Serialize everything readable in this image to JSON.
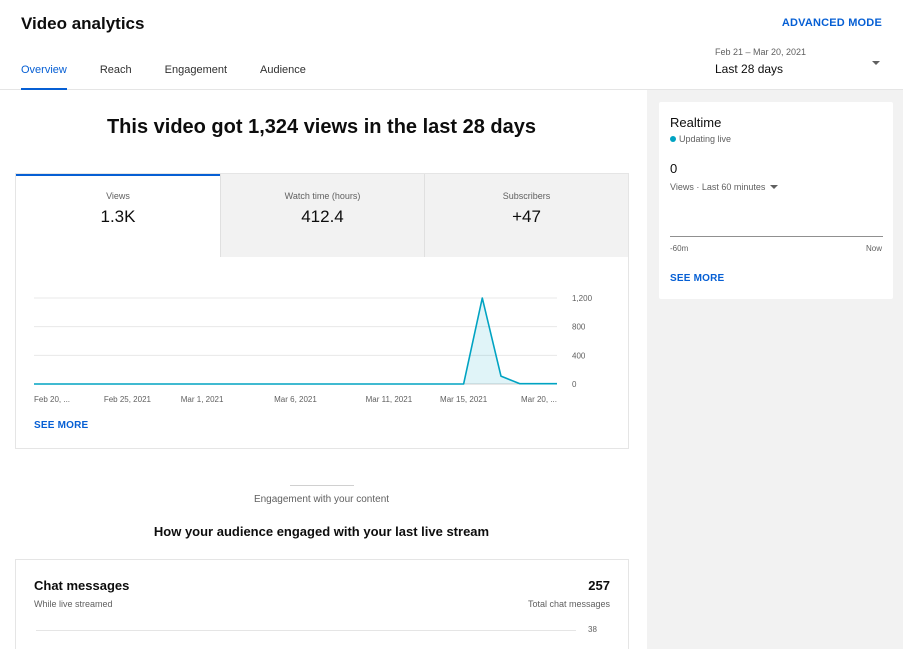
{
  "header": {
    "title": "Video analytics",
    "advanced_mode": "ADVANCED MODE",
    "tabs": [
      {
        "label": "Overview",
        "active": true
      },
      {
        "label": "Reach",
        "active": false
      },
      {
        "label": "Engagement",
        "active": false
      },
      {
        "label": "Audience",
        "active": false
      }
    ],
    "date_range": "Feb 21 – Mar 20, 2021",
    "date_label": "Last 28 days"
  },
  "main": {
    "headline": "This video got 1,324 views in the last 28 days",
    "metrics": [
      {
        "label": "Views",
        "value": "1.3K",
        "active": true
      },
      {
        "label": "Watch time (hours)",
        "value": "412.4",
        "active": false
      },
      {
        "label": "Subscribers",
        "value": "+47",
        "active": false
      }
    ],
    "see_more": "SEE MORE",
    "engagement_label": "Engagement with your content",
    "engagement_title": "How your audience engaged with your last live stream",
    "chat": {
      "title": "Chat messages",
      "subtitle": "While live streamed",
      "count": "257",
      "count_label": "Total chat messages",
      "axis_tick": "38"
    }
  },
  "chart_data": {
    "type": "area",
    "x": [
      "Feb 20",
      "Feb 21",
      "Feb 22",
      "Feb 23",
      "Feb 24",
      "Feb 25",
      "Feb 26",
      "Feb 27",
      "Feb 28",
      "Mar 1",
      "Mar 2",
      "Mar 3",
      "Mar 4",
      "Mar 5",
      "Mar 6",
      "Mar 7",
      "Mar 8",
      "Mar 9",
      "Mar 10",
      "Mar 11",
      "Mar 12",
      "Mar 13",
      "Mar 14",
      "Mar 15",
      "Mar 16",
      "Mar 17",
      "Mar 18",
      "Mar 19",
      "Mar 20"
    ],
    "series": [
      {
        "values": [
          0,
          0,
          0,
          0,
          0,
          0,
          0,
          0,
          0,
          0,
          0,
          0,
          0,
          0,
          0,
          0,
          0,
          0,
          0,
          0,
          0,
          0,
          0,
          0,
          1200,
          110,
          5,
          5,
          5
        ]
      }
    ],
    "x_tick_labels": [
      "Feb 20, ...",
      "Feb 25, 2021",
      "Mar 1, 2021",
      "Mar 6, 2021",
      "Mar 11, 2021",
      "Mar 15, 2021",
      "Mar 20, ..."
    ],
    "y_ticks": [
      "0",
      "400",
      "800",
      "1,200"
    ],
    "ylim": [
      0,
      1200
    ],
    "grid": true,
    "color": "#00a3c2"
  },
  "realtime": {
    "title": "Realtime",
    "status": "Updating live",
    "value": "0",
    "metric_label": "Views · Last 60 minutes",
    "axis_start": "-60m",
    "axis_end": "Now",
    "see_more": "SEE MORE"
  }
}
